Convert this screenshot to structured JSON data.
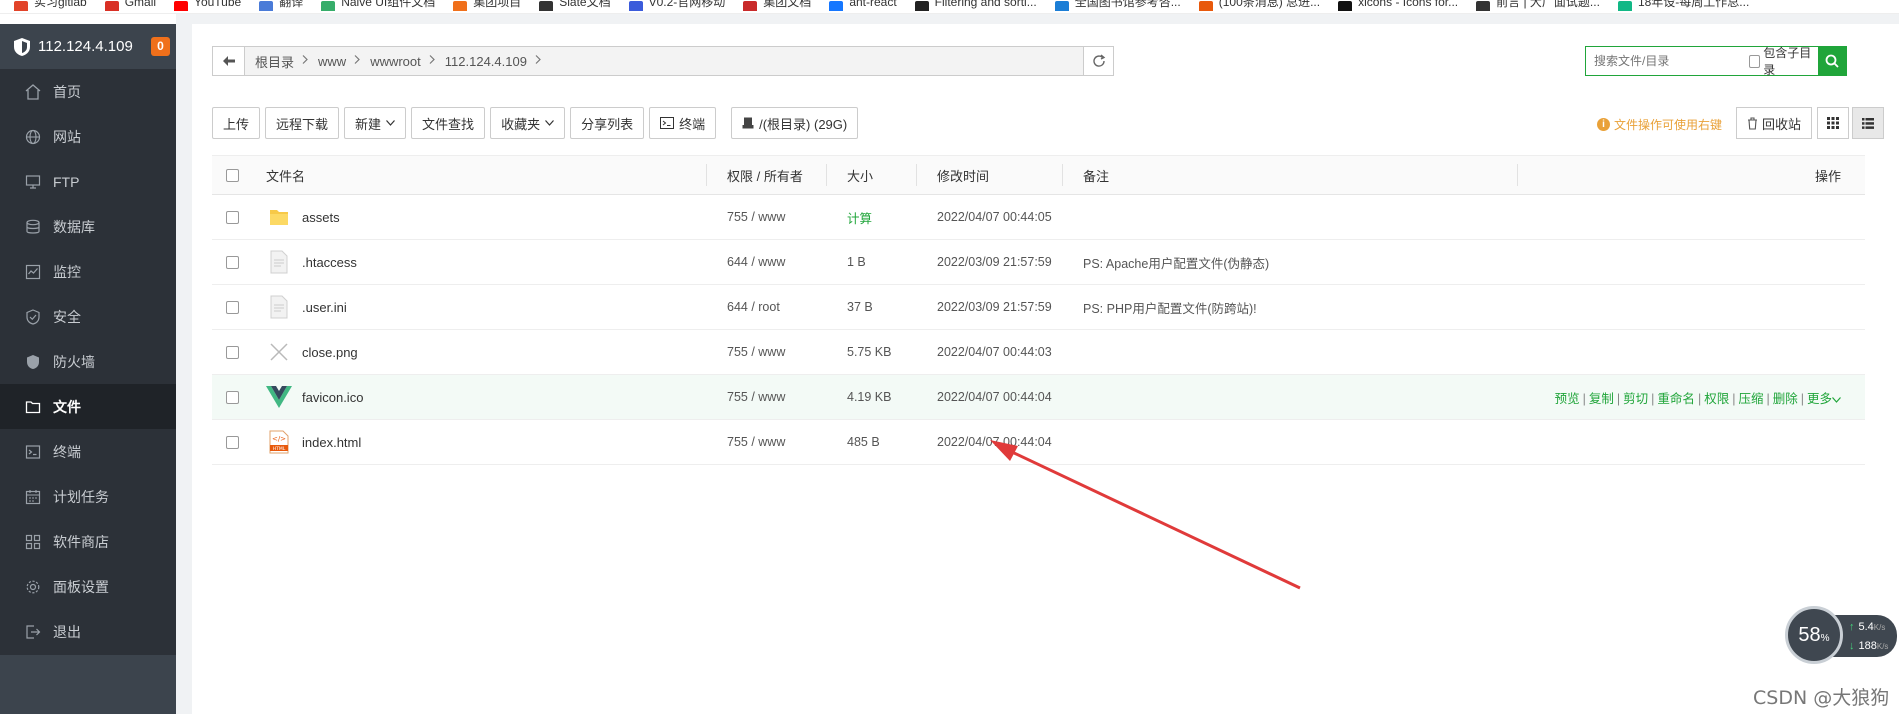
{
  "bookmarks": [
    {
      "label": "实习gitlab",
      "color": "#e24329"
    },
    {
      "label": "Gmail",
      "color": "#d93025"
    },
    {
      "label": "YouTube",
      "color": "#ff0000"
    },
    {
      "label": "翻译",
      "color": "#4a7bd8"
    },
    {
      "label": "Naive UI组件文档",
      "color": "#36ad6a"
    },
    {
      "label": "集团项目",
      "color": "#f0701b"
    },
    {
      "label": "Slate文档",
      "color": "#333333"
    },
    {
      "label": "V0.2-官网移动",
      "color": "#3b5bdb"
    },
    {
      "label": "集团文档",
      "color": "#c92a2a"
    },
    {
      "label": "ant-react",
      "color": "#1677ff"
    },
    {
      "label": "Filtering and sorti...",
      "color": "#222222"
    },
    {
      "label": "全国图书馆参考咨...",
      "color": "#1c7ed6"
    },
    {
      "label": "(100条消息) 总进...",
      "color": "#e8590c"
    },
    {
      "label": "xicons - Icons for...",
      "color": "#111111"
    },
    {
      "label": "前言 | 大厂面试题...",
      "color": "#333333"
    },
    {
      "label": "18年设-每周工作总...",
      "color": "#12b886"
    }
  ],
  "sidebar": {
    "ip": "112.124.4.109",
    "badge": "0",
    "items": [
      {
        "label": "首页",
        "icon": "home-icon"
      },
      {
        "label": "网站",
        "icon": "globe-icon"
      },
      {
        "label": "FTP",
        "icon": "ftp-icon"
      },
      {
        "label": "数据库",
        "icon": "database-icon"
      },
      {
        "label": "监控",
        "icon": "monitor-icon"
      },
      {
        "label": "安全",
        "icon": "security-shield-icon"
      },
      {
        "label": "防火墙",
        "icon": "firewall-icon"
      },
      {
        "label": "文件",
        "icon": "folder-icon"
      },
      {
        "label": "终端",
        "icon": "terminal-icon"
      },
      {
        "label": "计划任务",
        "icon": "calendar-icon"
      },
      {
        "label": "软件商店",
        "icon": "apps-icon"
      },
      {
        "label": "面板设置",
        "icon": "gear-icon"
      },
      {
        "label": "退出",
        "icon": "logout-icon"
      }
    ],
    "active_index": 7
  },
  "path": {
    "crumbs": [
      "根目录",
      "www",
      "wwwroot",
      "112.124.4.109"
    ]
  },
  "search": {
    "placeholder": "搜索文件/目录",
    "include_sub_label": "包含子目录"
  },
  "toolbar": {
    "upload": "上传",
    "remote_download": "远程下载",
    "new": "新建",
    "file_search": "文件查找",
    "favorites": "收藏夹",
    "share_list": "分享列表",
    "terminal": "终端",
    "disk": "/(根目录) (29G)",
    "tip": "文件操作可使用右键",
    "recycle": "回收站"
  },
  "table": {
    "headers": {
      "name": "文件名",
      "perm": "权限 / 所有者",
      "size": "大小",
      "mtime": "修改时间",
      "note": "备注",
      "ops": "操作"
    },
    "rows": [
      {
        "icon": "folder-icon",
        "name": "assets",
        "perm": "755 / www",
        "size": "计算",
        "mtime": "2022/04/07 00:44:05",
        "note": ""
      },
      {
        "icon": "file-icon",
        "name": ".htaccess",
        "perm": "644 / www",
        "size": "1 B",
        "mtime": "2022/03/09 21:57:59",
        "note": "PS: Apache用户配置文件(伪静态)"
      },
      {
        "icon": "file-icon",
        "name": ".user.ini",
        "perm": "644 / root",
        "size": "37 B",
        "mtime": "2022/03/09 21:57:59",
        "note": "PS: PHP用户配置文件(防跨站)!"
      },
      {
        "icon": "image-icon",
        "name": "close.png",
        "perm": "755 / www",
        "size": "5.75 KB",
        "mtime": "2022/04/07 00:44:03",
        "note": ""
      },
      {
        "icon": "vue-logo-icon",
        "name": "favicon.ico",
        "perm": "755 / www",
        "size": "4.19 KB",
        "mtime": "2022/04/07 00:44:04",
        "note": ""
      },
      {
        "icon": "html-file-icon",
        "name": "index.html",
        "perm": "755 / www",
        "size": "485 B",
        "mtime": "2022/04/07 00:44:04",
        "note": ""
      }
    ],
    "hover_row_index": 4,
    "row_actions": [
      "预览",
      "复制",
      "剪切",
      "重命名",
      "权限",
      "压缩",
      "删除",
      "更多"
    ]
  },
  "speed_widget": {
    "percent": "58",
    "percent_unit": "%",
    "upload": "5.4",
    "download": "188",
    "unit": "K/s"
  },
  "watermark": "CSDN @大狼狗",
  "colors": {
    "accent": "#20a53a",
    "sidebar_bg": "#2c3138",
    "tip": "#e9a138",
    "badge": "#f0701b",
    "annotation_arrow": "#e03a3a"
  }
}
